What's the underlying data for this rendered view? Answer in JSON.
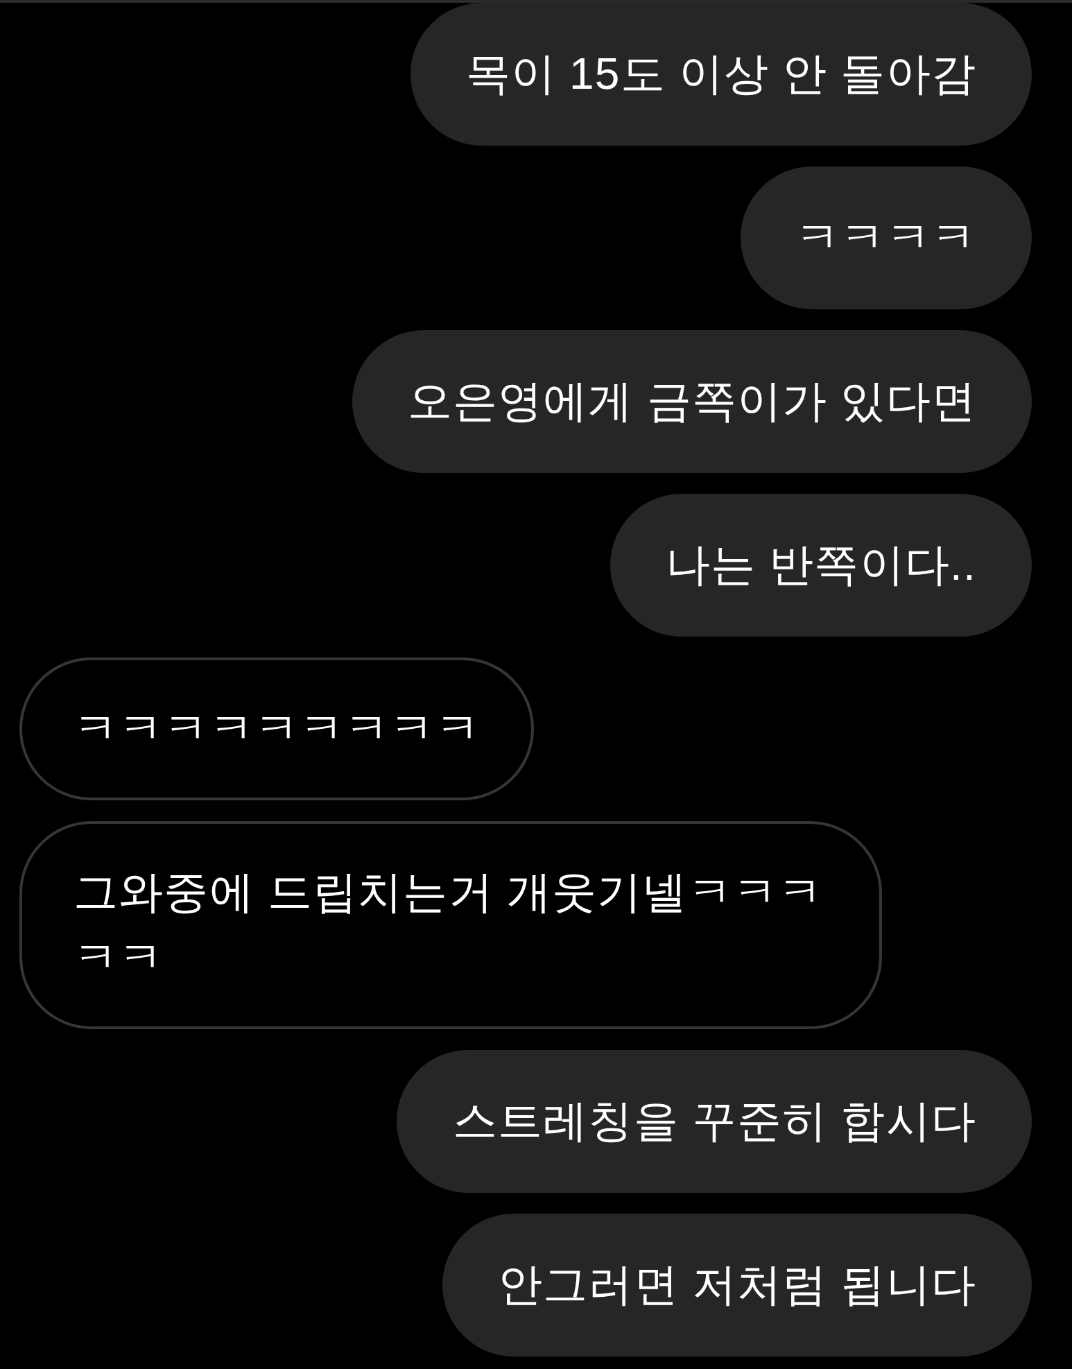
{
  "messages": [
    {
      "kind": "sent",
      "text": "목이 15도 이상 안 돌아감"
    },
    {
      "kind": "sent",
      "text": "ㅋㅋㅋㅋ"
    },
    {
      "kind": "sent",
      "text": "오은영에게 금쪽이가 있다면"
    },
    {
      "kind": "sent",
      "text": "나는 반쪽이다.."
    },
    {
      "kind": "received",
      "text": "ㅋㅋㅋㅋㅋㅋㅋㅋㅋ"
    },
    {
      "kind": "received",
      "text": "그와중에 드립치는거 개웃기넬ㅋㅋㅋㅋㅋ"
    },
    {
      "kind": "sent",
      "text": "스트레칭을 꾸준히 합시다"
    },
    {
      "kind": "sent",
      "text": "안그러면 저처럼 됩니다"
    }
  ]
}
